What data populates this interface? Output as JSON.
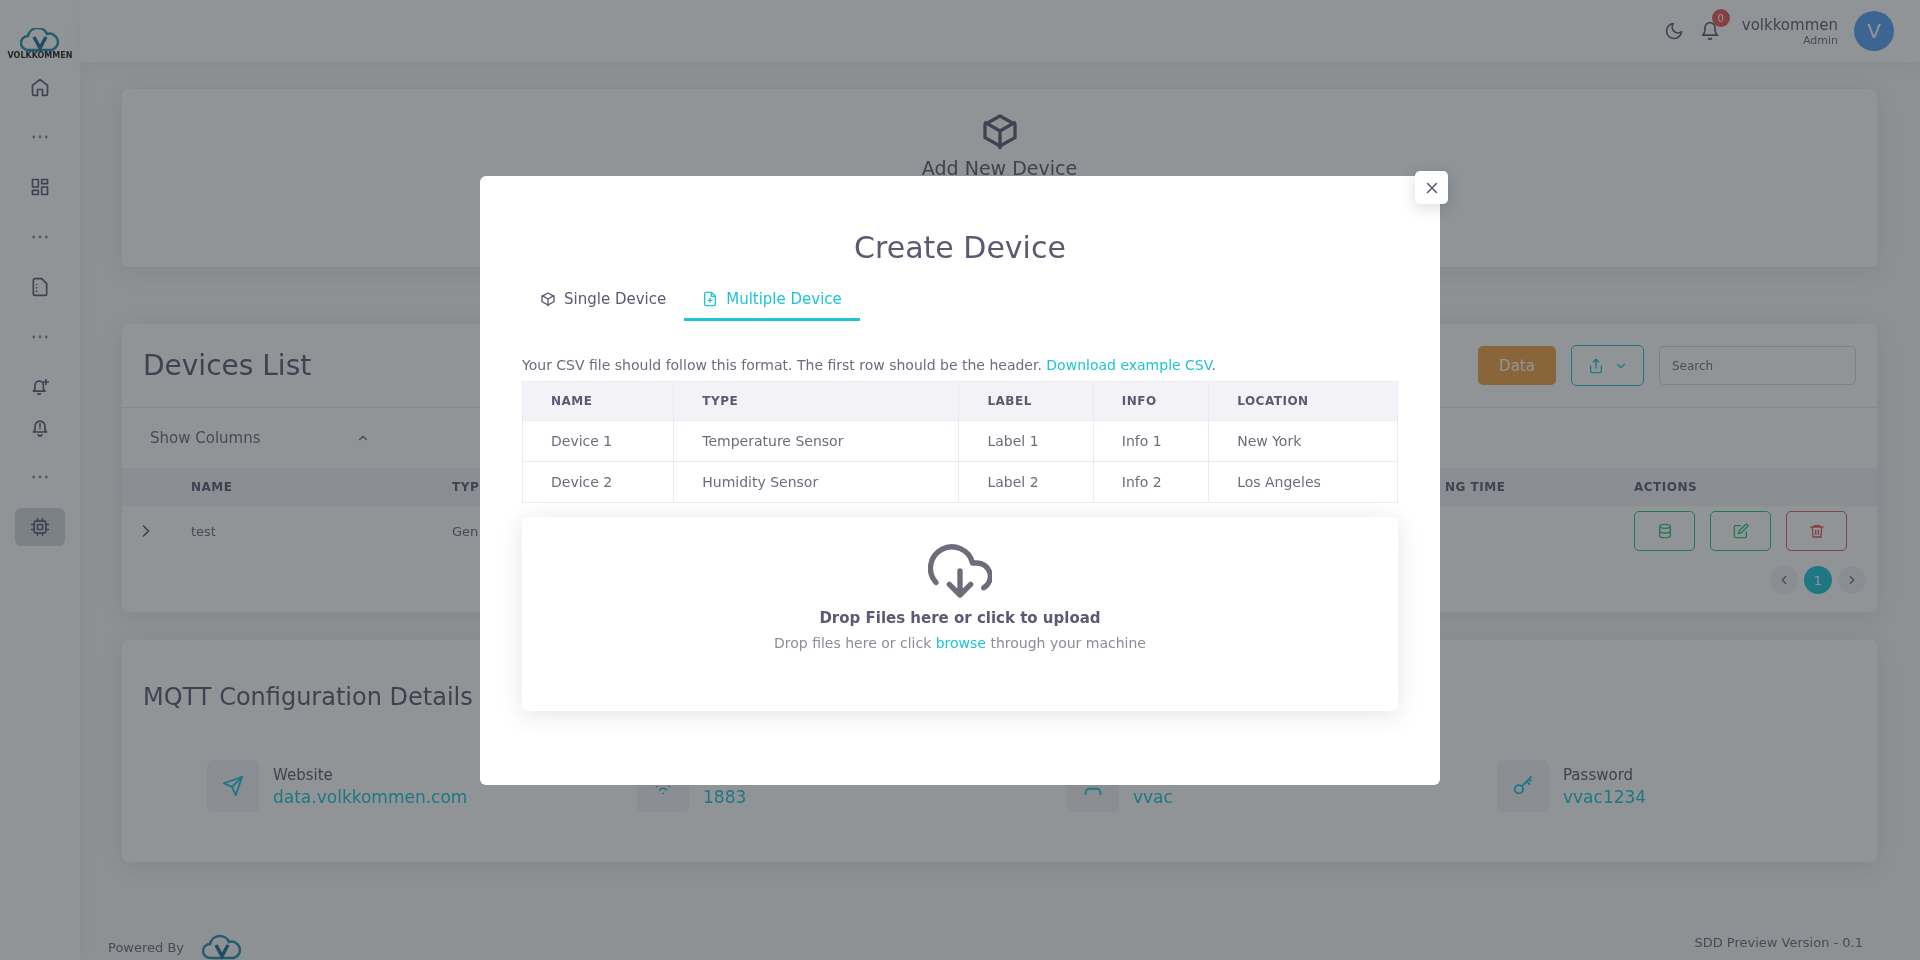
{
  "sidebar": {
    "logo_text": "VOLKKOMMEN",
    "items": [
      {
        "kind": "link",
        "selected": false
      },
      {
        "kind": "separator"
      },
      {
        "kind": "link",
        "selected": false
      },
      {
        "kind": "separator"
      },
      {
        "kind": "link",
        "selected": false
      },
      {
        "kind": "separator"
      },
      {
        "kind": "link",
        "selected": false
      },
      {
        "kind": "link",
        "selected": false
      },
      {
        "kind": "separator"
      },
      {
        "kind": "link",
        "selected": true
      }
    ]
  },
  "header": {
    "notifications": "0",
    "user": {
      "name": "volkkommen",
      "role": "Admin",
      "initial": "V"
    }
  },
  "add_device_card": {
    "title": "Add New Device"
  },
  "devices_card": {
    "title": "Devices List",
    "data_button": "Data",
    "search": {
      "placeholder": "Search"
    },
    "show_columns": {
      "label": "Show Columns",
      "expanded": true
    },
    "table": {
      "columns": [
        "NAME",
        "TYP",
        "NG TIME",
        "ACTIONS"
      ],
      "rows": [
        {
          "expanded": false,
          "cells": [
            "test",
            "Gen"
          ]
        }
      ]
    },
    "pagination": [
      {
        "label": "1",
        "selected": true
      }
    ]
  },
  "mqtt": {
    "title": "MQTT Configuration Details",
    "items": [
      {
        "label": "Website",
        "value": "data.volkkommen.com"
      },
      {
        "value": "1883"
      },
      {
        "value": "vvac"
      },
      {
        "label": "Password",
        "value": "vvac1234"
      }
    ]
  },
  "footer": {
    "powered_by": "Powered By",
    "version": "SDD Preview Version - 0.1"
  },
  "modal": {
    "title": "Create Device",
    "tabs": [
      {
        "label": "Single Device",
        "selected": false
      },
      {
        "label": "Multiple Device",
        "selected": true
      }
    ],
    "instruction": {
      "text": "Your CSV file should follow this format. The first row should be the header.",
      "link": "Download example CSV",
      "after": "."
    },
    "table": {
      "columns": [
        "NAME",
        "TYPE",
        "LABEL",
        "INFO",
        "LOCATION"
      ],
      "rows": [
        [
          "Device 1",
          "Temperature Sensor",
          "Label 1",
          "Info 1",
          "New York"
        ],
        [
          "Device 2",
          "Humidity Sensor",
          "Label 2",
          "Info 2",
          "Los Angeles"
        ]
      ]
    },
    "dropzone": {
      "title": "Drop Files here or click to upload",
      "text": "Drop files here or click",
      "link": "browse",
      "after": "through your machine"
    }
  }
}
